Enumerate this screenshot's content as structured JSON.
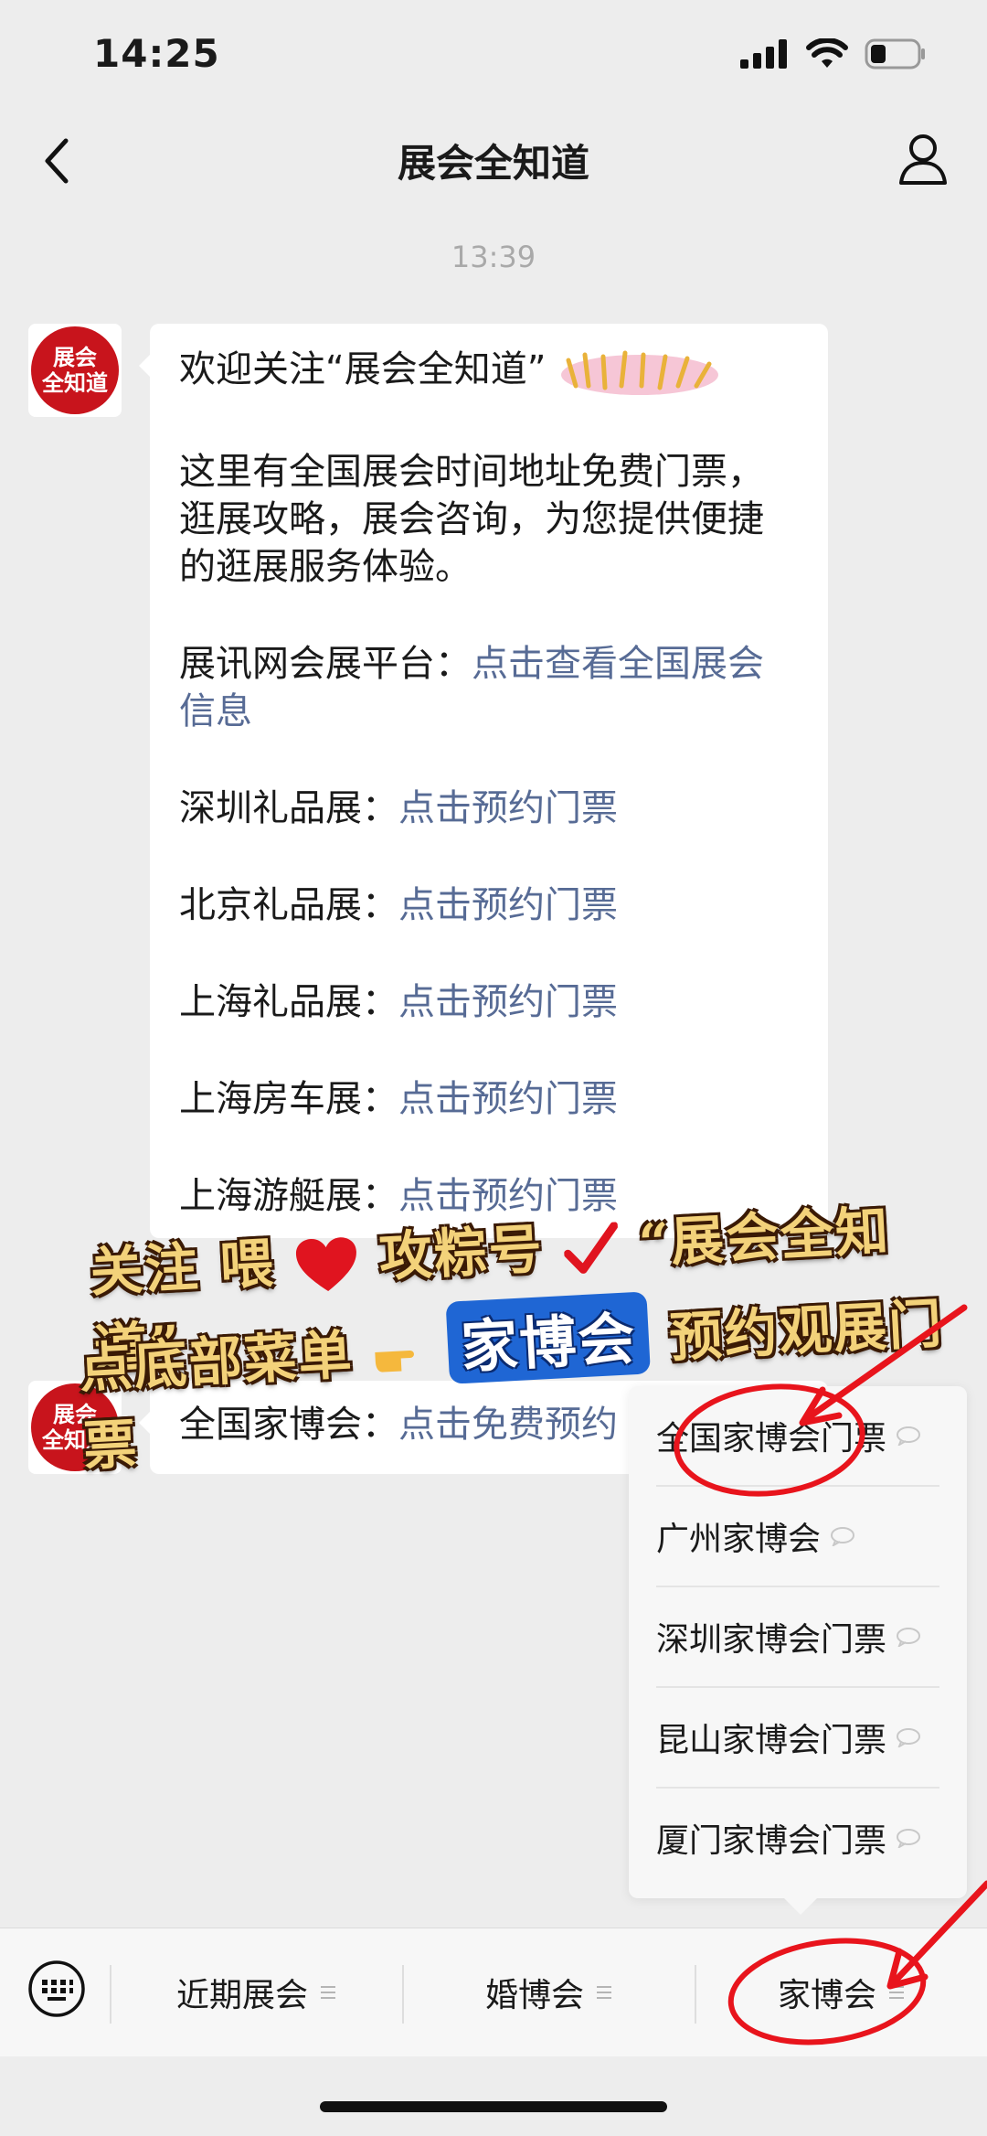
{
  "status": {
    "time": "14:25"
  },
  "nav": {
    "title": "展会全知道"
  },
  "timestamp": "13:39",
  "avatar": {
    "line1": "展会",
    "line2": "全知道"
  },
  "message1": {
    "welcome": "欢迎关注“展会全知道”",
    "intro": "这里有全国展会时间地址免费门票，逛展攻略，展会咨询，为您提供便捷的逛展服务体验。",
    "rows": [
      {
        "label": "展讯网会展平台：",
        "link": "点击查看全国展会信息"
      },
      {
        "label": "深圳礼品展：",
        "link": "点击预约门票"
      },
      {
        "label": "北京礼品展：",
        "link": "点击预约门票"
      },
      {
        "label": "上海礼品展：",
        "link": "点击预约门票"
      },
      {
        "label": "上海房车展：",
        "link": "点击预约门票"
      },
      {
        "label": "上海游艇展：",
        "link": "点击预约门票"
      }
    ]
  },
  "message2": {
    "label": "全国家博会：",
    "link": "点击免费预约"
  },
  "banner": {
    "line1_a": "关注",
    "line1_b": "喂",
    "line1_c": "攻粽号",
    "line1_d": "“展会全知道”",
    "line2_a": "点底部菜单",
    "line2_pill": "家博会",
    "line2_b": "预约观展门票"
  },
  "popup": {
    "items": [
      "全国家博会门票",
      "广州家博会",
      "深圳家博会门票",
      "昆山家博会门票",
      "厦门家博会门票"
    ]
  },
  "bottom_tabs": [
    "近期展会",
    "婚博会",
    "家博会"
  ],
  "colors": {
    "link": "#576b95",
    "annotation": "#e8141c",
    "avatar": "#c8141c"
  }
}
